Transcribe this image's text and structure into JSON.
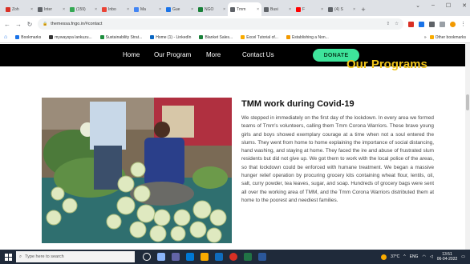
{
  "browser": {
    "tabs": [
      {
        "label": "Zoh",
        "color": "#d93025"
      },
      {
        "label": "Inter",
        "color": "#5f6368"
      },
      {
        "label": "(159)",
        "color": "#34a853"
      },
      {
        "label": "Inbo",
        "color": "#ea4335"
      },
      {
        "label": "Ma",
        "color": "#4285f4"
      },
      {
        "label": "Gue",
        "color": "#1a73e8"
      },
      {
        "label": "NGO",
        "color": "#188038"
      },
      {
        "label": "Tmm",
        "color": "#5f6368"
      },
      {
        "label": "Busi",
        "color": "#5f6368"
      },
      {
        "label": "F",
        "color": "#ff0000"
      },
      {
        "label": "(4) S",
        "color": "#5f6368"
      }
    ],
    "new_tab": "+",
    "window_controls": [
      "⌄",
      "–",
      "☐",
      "✕"
    ],
    "url": "themessa.fngo.in/#contact",
    "bookmarks": [
      {
        "label": "Bookmarks",
        "color": "#1a73e8"
      },
      {
        "label": "mywayspa lankuzu...",
        "color": "#333333"
      },
      {
        "label": "Sustainability Strat...",
        "color": "#1e8e3e"
      },
      {
        "label": "Home (1) - LinkedIn",
        "color": "#0a66c2"
      },
      {
        "label": "Blanket Sales...",
        "color": "#188038"
      },
      {
        "label": "Excel Tutorial of...",
        "color": "#f9ab00"
      },
      {
        "label": "Establishing a Non...",
        "color": "#f29900"
      }
    ],
    "bookmarks_more": "»",
    "other_bookmarks": "Other bookmarks"
  },
  "site": {
    "nav": [
      "Home",
      "Our Program",
      "More",
      "Contact Us"
    ],
    "donate": "DONATE",
    "heading": "Our Programs",
    "article_title": "TMM work during Covid-19",
    "article_body": "We stepped in immediately on the first day of the lockdown. In every area we formed teams of Tmm's volunteers, calling them Tmm Corona Warriors. These brave young girls and boys showed exemplary courage at a time when not a soul entered the slums. They went from home to home explaining the importance of social distancing, hand washing, and staying at home. They faced the ire and abuse of frustrated slum residents but did not give up. We got them to work with the local police of the areas, so that lockdown could be enforced with humane treatment. We began a massive hunger relief operation by procuring grocery kits containing wheat flour, lentils, oil, salt, curry powder, tea leaves, sugar, and soap. Hundreds of grocery bags were sent all over the working area of TMM, and the Tmm Corona Warriors distributed them at home to the poorest and neediest families."
  },
  "taskbar": {
    "search_placeholder": "Type here to search",
    "weather": "37°C",
    "time": "13:51",
    "date": "06-04-2022",
    "lang": "ENG"
  }
}
